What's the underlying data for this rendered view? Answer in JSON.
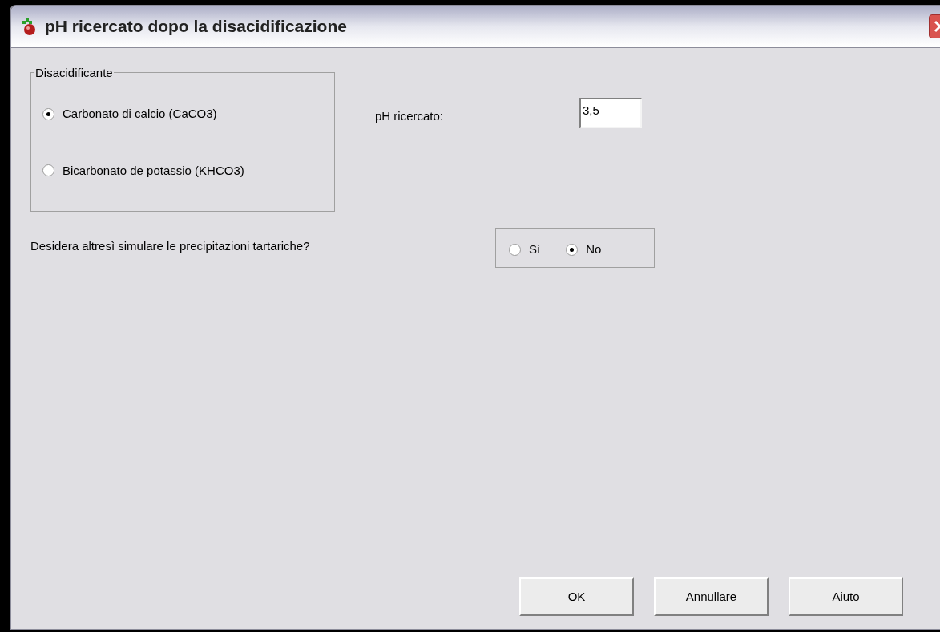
{
  "window": {
    "title": "pH ricercato dopo la disacidificazione"
  },
  "disacidifier_group": {
    "legend": "Disacidificante",
    "options": [
      {
        "label": "Carbonato di calcio (CaCO3)",
        "selected": true
      },
      {
        "label": "Bicarbonato de potassio (KHCO3)",
        "selected": false
      }
    ]
  },
  "target_ph": {
    "label": "pH ricercato:",
    "value": "3,5"
  },
  "tartaric_question": {
    "label": "Desidera altresì simulare le precipitazioni tartariche?",
    "options": [
      {
        "label": "Sì",
        "selected": false
      },
      {
        "label": "No",
        "selected": true
      }
    ]
  },
  "buttons": [
    "OK",
    "Annullare",
    "Aiuto"
  ]
}
